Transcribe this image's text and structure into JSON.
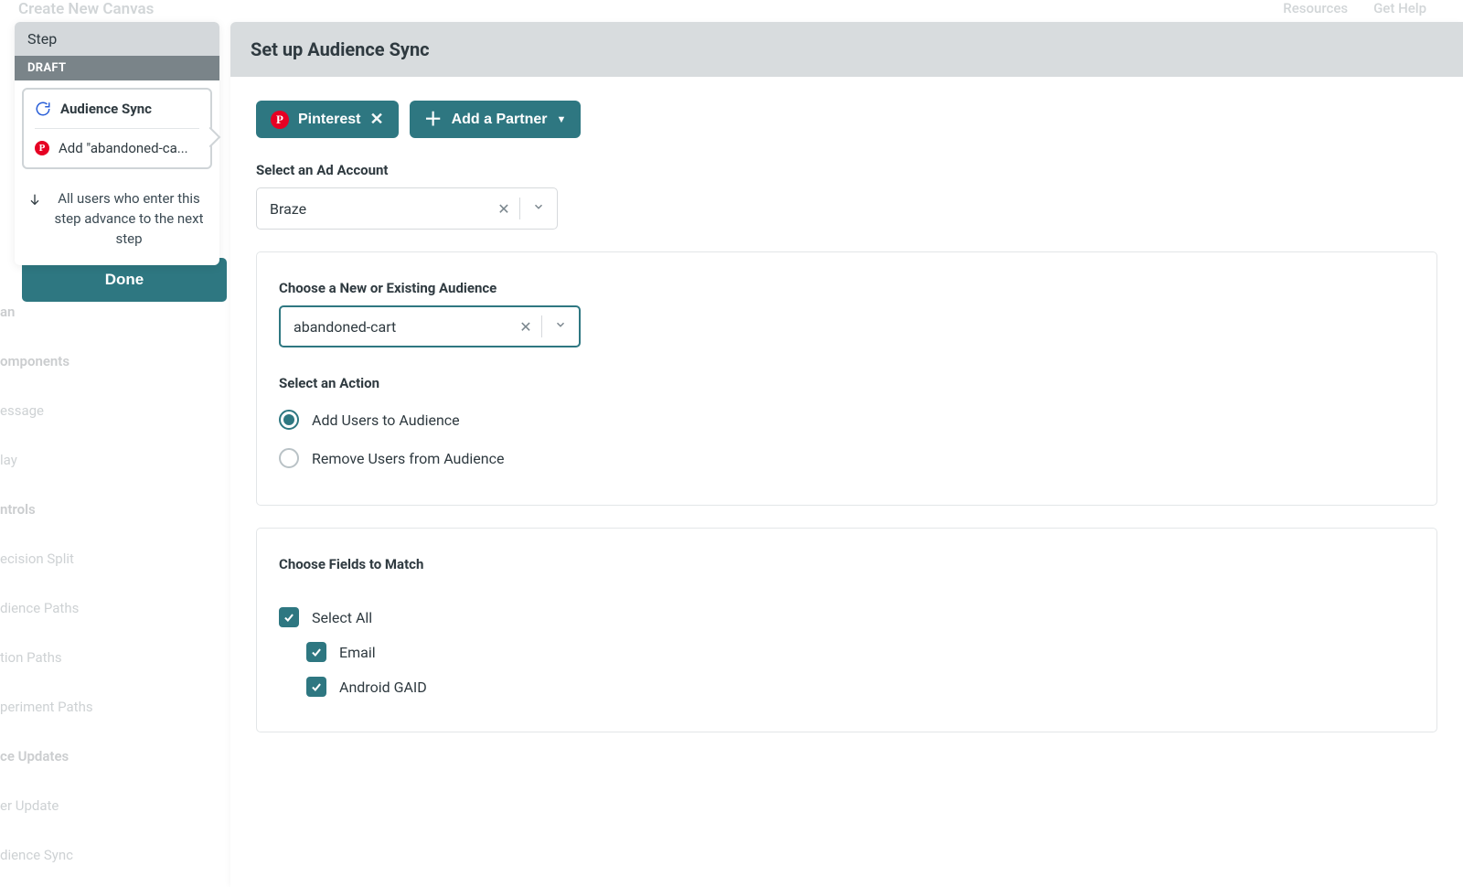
{
  "background": {
    "title": "Create New Canvas",
    "topmenu": [
      "Resources",
      "Get Help"
    ],
    "sidebar": [
      {
        "label": "an",
        "section": true
      },
      {
        "label": "omponents",
        "section": true
      },
      {
        "label": "essage"
      },
      {
        "label": "lay"
      },
      {
        "label": "ntrols",
        "section": true
      },
      {
        "label": "ecision Split"
      },
      {
        "label": "dience Paths"
      },
      {
        "label": "tion Paths"
      },
      {
        "label": "periment Paths"
      },
      {
        "label": "ce Updates",
        "section": true
      },
      {
        "label": "er Update"
      },
      {
        "label": "dience Sync"
      }
    ]
  },
  "stepPanel": {
    "header": "Step",
    "status": "DRAFT",
    "row1": "Audience Sync",
    "row2": "Add \"abandoned-ca...",
    "note": "All users who enter this step advance to the next step",
    "doneLabel": "Done"
  },
  "main": {
    "title": "Set up Audience Sync",
    "partnerChip": "Pinterest",
    "addPartner": "Add a Partner",
    "adAccountLabel": "Select an Ad Account",
    "adAccountValue": "Braze",
    "audienceLabel": "Choose a New or Existing Audience",
    "audienceValue": "abandoned-cart",
    "actionLabel": "Select an Action",
    "actions": {
      "add": "Add Users to Audience",
      "remove": "Remove Users from Audience"
    },
    "fieldsLabel": "Choose Fields to Match",
    "selectAll": "Select All",
    "fields": [
      "Email",
      "Android GAID"
    ]
  }
}
